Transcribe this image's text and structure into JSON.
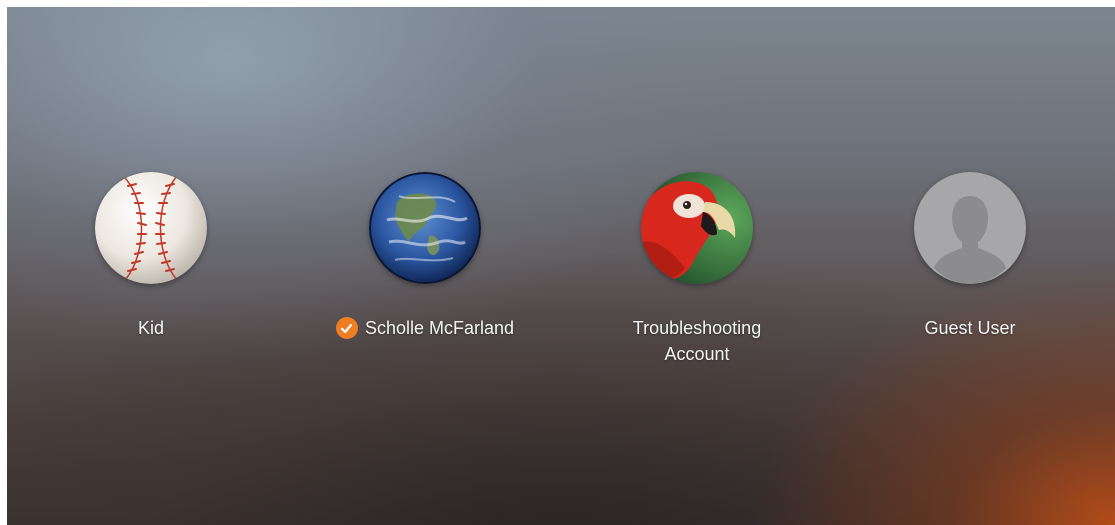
{
  "login_window": {
    "users": [
      {
        "name": "Kid",
        "avatar_icon": "baseball-icon",
        "logged_in": false
      },
      {
        "name": "Scholle McFarland",
        "avatar_icon": "earth-globe-icon",
        "logged_in": true
      },
      {
        "name_line1": "Troubleshooting",
        "name_line2": "Account",
        "avatar_icon": "parrot-icon",
        "logged_in": false
      },
      {
        "name": "Guest User",
        "avatar_icon": "silhouette-icon",
        "logged_in": false
      }
    ],
    "colors": {
      "checkmark_badge": "#f07d22",
      "label_text": "#f4f4f4"
    }
  }
}
